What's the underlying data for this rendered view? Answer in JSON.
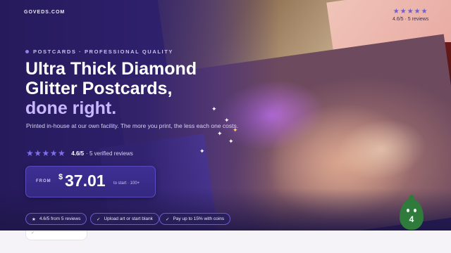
{
  "brand": {
    "logo_text": "GOVEDS.COM"
  },
  "top_rating": {
    "stars": "★★★★★",
    "text": "4.6/5 · 5 reviews"
  },
  "hero": {
    "eyebrow": "POSTCARDS · PROFESSIONAL QUALITY",
    "title_line1": "Ultra Thick Diamond",
    "title_line2": "Glitter Postcards,",
    "title_accent": "done right.",
    "description": "Printed in-house at our own facility. The more you print, the less each one costs.",
    "rating_stars": "★★★★★",
    "rating_score": "4.6/5",
    "rating_verified": "· 5 verified reviews"
  },
  "price": {
    "from_label": "FROM",
    "currency": "$",
    "amount": "37.01",
    "note": "to start · 100+"
  },
  "trust_pills": [
    {
      "icon": "★",
      "label": "4.6/5 from 5 reviews"
    },
    {
      "icon": "✓",
      "label": "Upload art or start blank"
    },
    {
      "icon": "✓",
      "label": "Pay up to 15% with coins"
    }
  ],
  "strip": {
    "tick": "✓"
  },
  "mascot": {
    "badge": "4"
  },
  "colors": {
    "accent": "#7c6ff0",
    "hero_bg": "#2a1e5c",
    "title_accent": "#c9b8ff"
  }
}
